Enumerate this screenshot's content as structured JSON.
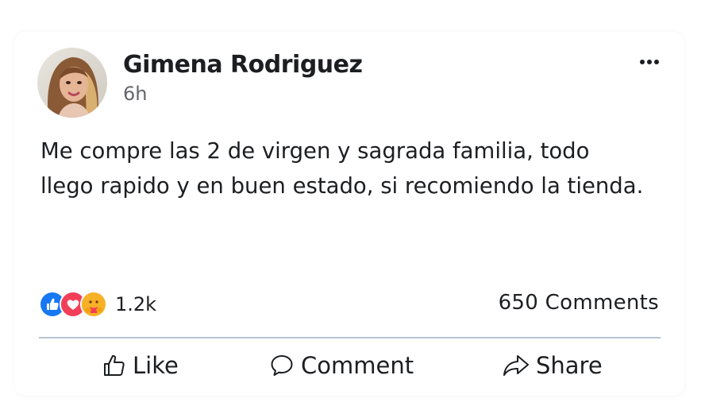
{
  "post": {
    "author_name": "Gimena Rodriguez",
    "timestamp": "6h",
    "text": "Me compre las 2 de virgen y sagrada familia, todo llego rapido y en buen estado, si recomiendo la tienda."
  },
  "reactions": {
    "icons": [
      "like-icon",
      "love-icon",
      "care-icon"
    ],
    "count": "1.2k"
  },
  "comments": {
    "count_label": "650 Comments"
  },
  "actions": {
    "like_label": "Like",
    "comment_label": "Comment",
    "share_label": "Share"
  },
  "colors": {
    "like_blue": "#1877f2",
    "love_red": "#f33e58",
    "care_yellow": "#f7b125",
    "divider": "#b8c4d2"
  }
}
